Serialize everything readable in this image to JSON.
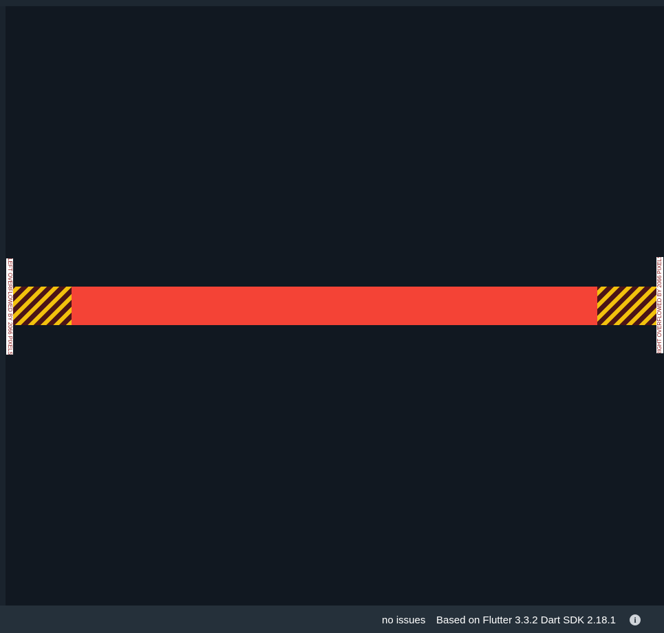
{
  "preview": {
    "overflow_left_label": "LEFT OVERFLOWED BY 2066 PIXELS",
    "overflow_right_label": "RIGHT OVERFLOWED BY 2066 PIXELS",
    "colors": {
      "background": "#111821",
      "bar": "#f44336",
      "stripe_yellow": "#f2c10d",
      "stripe_dark": "#4a1418"
    }
  },
  "status_bar": {
    "issues": "no issues",
    "sdk_info": "Based on Flutter 3.3.2 Dart SDK 2.18.1",
    "info_icon": "info-icon",
    "info_glyph": "i"
  }
}
